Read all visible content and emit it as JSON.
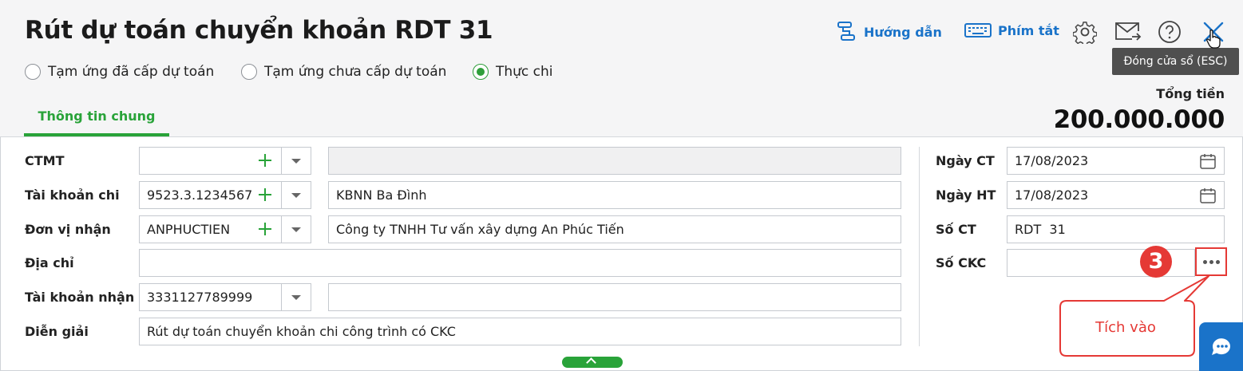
{
  "window": {
    "title": "Rút dự toán chuyển khoản RDT 31",
    "toolbar": {
      "guide_label": "Hướng dẫn",
      "shortcut_label": "Phím tắt"
    },
    "close_tooltip": "Đóng cửa sổ (ESC)"
  },
  "payment_type": {
    "options": [
      {
        "label": "Tạm ứng đã cấp dự toán",
        "selected": false
      },
      {
        "label": "Tạm ứng chưa cấp dự toán",
        "selected": false
      },
      {
        "label": "Thực chi",
        "selected": true
      }
    ]
  },
  "tabs": [
    {
      "label": "Thông tin chung",
      "active": true
    }
  ],
  "total": {
    "label": "Tổng tiền",
    "value": "200.000.000"
  },
  "form": {
    "ctmt": {
      "label": "CTMT",
      "value": "",
      "description": ""
    },
    "expense_account": {
      "label": "Tài khoản chi",
      "value": "9523.3.1234567",
      "description": "KBNN Ba Đình"
    },
    "recipient": {
      "label": "Đơn vị nhận",
      "value": "ANPHUCTIEN",
      "description": "Công ty TNHH Tư vấn xây dựng An Phúc Tiến"
    },
    "address": {
      "label": "Địa chỉ",
      "value": ""
    },
    "receiving_account": {
      "label": "Tài khoản nhận",
      "value": "3331127789999",
      "description": ""
    },
    "explanation": {
      "label": "Diễn giải",
      "value": "Rút dự toán chuyển khoản chi công trình có CKC"
    }
  },
  "right_form": {
    "voucher_date": {
      "label": "Ngày CT",
      "value": "17/08/2023"
    },
    "posting_date": {
      "label": "Ngày HT",
      "value": "17/08/2023"
    },
    "voucher_no": {
      "label": "Số CT",
      "value": "RDT  31"
    },
    "ckc_no": {
      "label": "Số CKC",
      "value": ""
    }
  },
  "annotation": {
    "step_number": "3",
    "callout_text": "Tích vào",
    "color": "#e53935"
  },
  "colors": {
    "accent_green": "#29a339",
    "link_blue": "#1a73c9",
    "highlight_red": "#e53935"
  },
  "icons": [
    "route-icon",
    "keyboard-icon",
    "gear-icon",
    "mail-forward-icon",
    "help-icon",
    "close-icon",
    "plus-icon",
    "chevron-down-icon",
    "calendar-icon",
    "more-icon",
    "chevron-up-icon",
    "chat-icon"
  ]
}
